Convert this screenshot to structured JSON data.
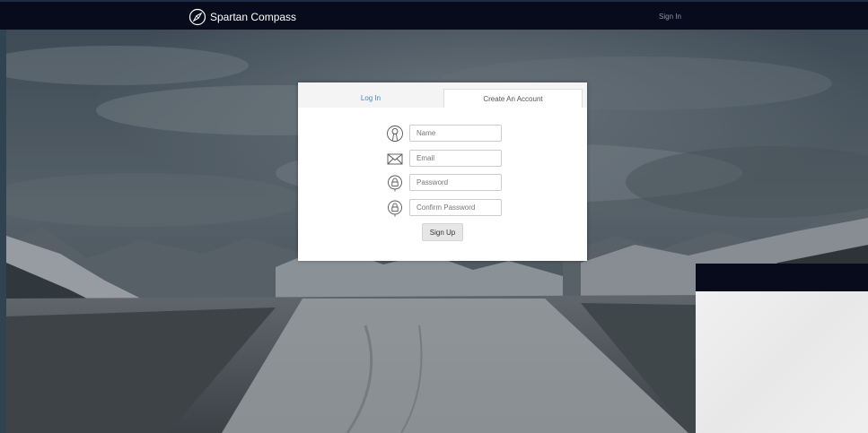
{
  "navbar": {
    "brand_name": "Spartan Compass",
    "brand_icon": "compass-icon",
    "sign_in_link": "Sign In",
    "background_color": "#070b1c"
  },
  "auth_card": {
    "tabs": [
      {
        "label": "Log In",
        "active": false
      },
      {
        "label": "Create An Account",
        "active": true
      }
    ],
    "fields": [
      {
        "icon": "user-icon",
        "placeholder": "Name",
        "value": ""
      },
      {
        "icon": "envelope-icon",
        "placeholder": "Email",
        "value": ""
      },
      {
        "icon": "lock-icon",
        "placeholder": "Password",
        "value": ""
      },
      {
        "icon": "lock-icon",
        "placeholder": "Confirm Password",
        "value": ""
      }
    ],
    "submit_label": "Sign Up",
    "link_color": "#4a86c5"
  }
}
